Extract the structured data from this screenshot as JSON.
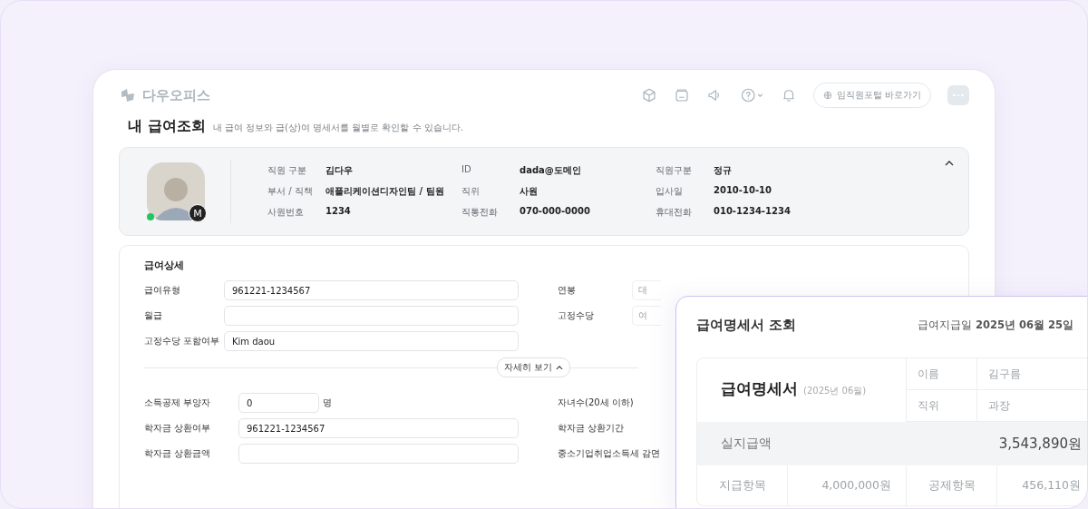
{
  "brand": {
    "name": "다우오피스"
  },
  "toolbar": {
    "portal_button": "임직원포털 바로가기"
  },
  "page": {
    "title": "내 급여조회",
    "description": "내 급여 정보와 급(상)여 명세서를 월별로 확인할 수 있습니다."
  },
  "profile": {
    "online": true,
    "badge": "M",
    "expanded": true,
    "fields": [
      {
        "label": "직원 구분",
        "value": "김다우"
      },
      {
        "label": "ID",
        "value": "dada@도메인"
      },
      {
        "label": "직원구분",
        "value": "정규"
      },
      {
        "label": "부서 / 직책",
        "value": "애플리케이션디자인팀 / 팀원"
      },
      {
        "label": "직위",
        "value": "사원"
      },
      {
        "label": "입사일",
        "value": "2010-10-10"
      },
      {
        "label": "사원번호",
        "value": "1234"
      },
      {
        "label": "직통전화",
        "value": "070-000-0000"
      },
      {
        "label": "휴대전화",
        "value": "010-1234-1234"
      }
    ]
  },
  "salary_detail": {
    "title": "급여상세",
    "more_button": "자세히 보기",
    "expanded": true,
    "rows": [
      {
        "label": "급여유형",
        "value": "961221-1234567",
        "right_label": "연봉",
        "right_value": "대"
      },
      {
        "label": "월급",
        "right_label": "고정수당",
        "right_value": "여"
      },
      {
        "label": "고정수당 포함여부",
        "value": "Kim daou"
      }
    ],
    "deduction_rows": [
      {
        "label": "소득공제 부양자",
        "kind": "count",
        "value": "0",
        "unit": "명",
        "right_label": "자녀수(20세 이하)"
      },
      {
        "label": "학자금 상환여부",
        "kind": "text",
        "value": "961221-1234567",
        "right_label": "학자금 상환기간"
      },
      {
        "label": "학자금 상환금액",
        "kind": "text",
        "right_label": "중소기업취업소득세 감면"
      }
    ]
  },
  "payslip": {
    "title": "급여명세서 조회",
    "pay_date_label": "급여지급일",
    "pay_date": "2025년 06월 25일",
    "doc_title": "급여명세서",
    "period": "(2025년 06월)",
    "info": [
      {
        "label": "이름",
        "value": "김구름"
      },
      {
        "label": "직위",
        "value": "과장"
      }
    ],
    "net_label": "실지급액",
    "net_value": "3,543,890원",
    "totals": [
      {
        "label": "지급항목",
        "value": "4,000,000원"
      },
      {
        "label": "공제항목",
        "value": "456,110원"
      }
    ]
  }
}
